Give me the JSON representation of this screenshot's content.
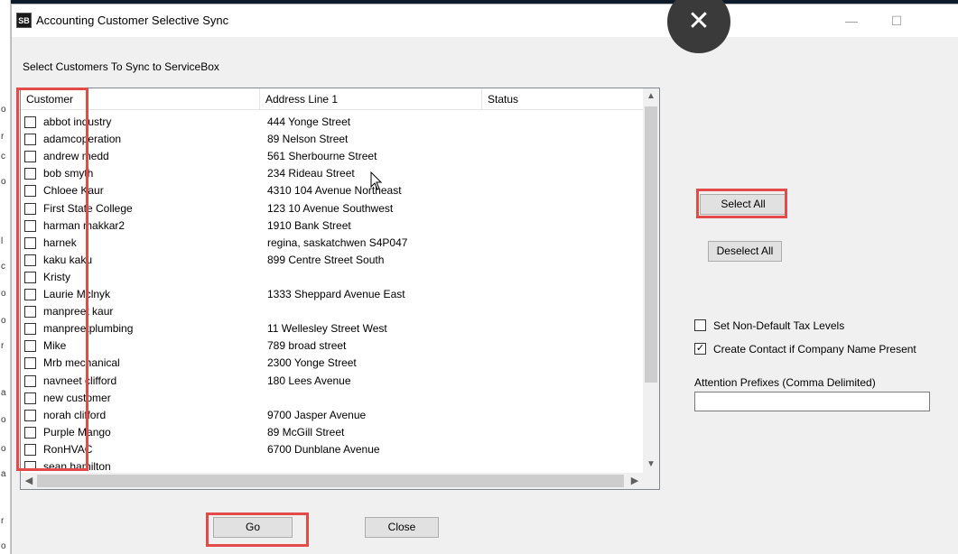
{
  "window": {
    "title": "Accounting Customer Selective Sync",
    "app_icon": "SB"
  },
  "instructions": "Select Customers To Sync to ServiceBox",
  "list": {
    "columns": [
      "Customer",
      "Address Line 1",
      "Status"
    ],
    "rows": [
      {
        "name": "abbot  industry",
        "address": "444 Yonge Street"
      },
      {
        "name": "adamcoperation",
        "address": "89 Nelson Street"
      },
      {
        "name": "andrew  medd",
        "address": "561 Sherbourne Street"
      },
      {
        "name": "bob smyth",
        "address": "234 Rideau Street"
      },
      {
        "name": "Chloee Kaur",
        "address": "4310 104 Avenue Northeast"
      },
      {
        "name": "First State College",
        "address": "123 10 Avenue Southwest"
      },
      {
        "name": "harman makkar2",
        "address": "1910 Bank Street"
      },
      {
        "name": "harnek",
        "address": "regina, saskatchwen S4P047"
      },
      {
        "name": "kaku kaku",
        "address": "899 Centre Street South"
      },
      {
        "name": "Kristy",
        "address": ""
      },
      {
        "name": "Laurie Mclnyk",
        "address": "1333 Sheppard Avenue East"
      },
      {
        "name": "manpreet kaur",
        "address": ""
      },
      {
        "name": "manpreetplumbing",
        "address": "11 Wellesley Street West"
      },
      {
        "name": "Mike",
        "address": "789 broad street"
      },
      {
        "name": "Mrb mechanical",
        "address": "2300 Yonge Street"
      },
      {
        "name": "navneet clifford",
        "address": "180 Lees Avenue"
      },
      {
        "name": "new customer",
        "address": ""
      },
      {
        "name": "norah  clifford",
        "address": "9700 Jasper Avenue"
      },
      {
        "name": "Purple Mango",
        "address": "89 McGill Street"
      },
      {
        "name": "RonHVAC",
        "address": "6700 Dunblane Avenue"
      },
      {
        "name": "sean hamilton",
        "address": ""
      }
    ]
  },
  "buttons": {
    "select_all": "Select All",
    "deselect_all": "Deselect All",
    "go": "Go",
    "close": "Close"
  },
  "options": {
    "non_default_tax": {
      "label": "Set Non-Default Tax Levels",
      "checked": false
    },
    "create_contact": {
      "label": "Create Contact if Company Name Present",
      "checked": true
    }
  },
  "attention": {
    "label": "Attention Prefixes (Comma Delimited)",
    "value": ""
  },
  "titlebar_glyphs": {
    "minimize": "—",
    "maximize": "☐",
    "overlay_close": "✕"
  },
  "colors": {
    "highlight": "#e34b4b"
  }
}
